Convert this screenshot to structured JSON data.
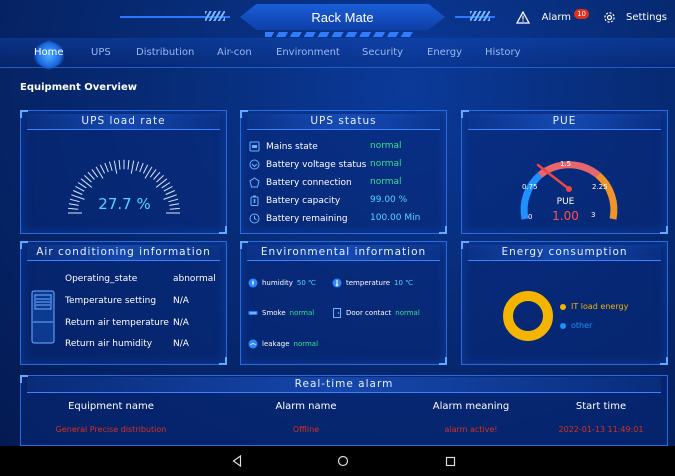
{
  "header": {
    "title": "Rack Mate",
    "alarm_label": "Alarm",
    "alarm_count": "10",
    "settings_label": "Settings"
  },
  "nav": {
    "items": [
      {
        "label": "Home"
      },
      {
        "label": "UPS"
      },
      {
        "label": "Distribution"
      },
      {
        "label": "Air-con"
      },
      {
        "label": "Environment"
      },
      {
        "label": "Security"
      },
      {
        "label": "Energy"
      },
      {
        "label": "History"
      }
    ]
  },
  "overview_title": "Equipment Overview",
  "ups_load": {
    "title": "UPS load rate",
    "value_text": "27.7 %",
    "value": 27.7
  },
  "ups_status": {
    "title": "UPS status",
    "rows": [
      {
        "label": "Mains state",
        "value": "normal",
        "icon": "plug-icon"
      },
      {
        "label": "Battery voltage status",
        "value": "normal",
        "icon": "voltage-icon"
      },
      {
        "label": "Battery connection",
        "value": "normal",
        "icon": "link-icon"
      },
      {
        "label": "Battery capacity",
        "value": "99.00 %",
        "icon": "battery-icon"
      },
      {
        "label": "Battery remaining",
        "value": "100.00 Min",
        "icon": "clock-icon"
      }
    ]
  },
  "pue": {
    "title": "PUE",
    "label": "PUE",
    "value": "1.00",
    "ticks": [
      "0",
      "0.75",
      "1.5",
      "2.25",
      "3"
    ]
  },
  "aircon": {
    "title": "Air conditioning information",
    "rows": [
      {
        "label": "Operating_state",
        "value": "abnormal"
      },
      {
        "label": "Temperature setting",
        "value": "N/A"
      },
      {
        "label": "Return air temperature",
        "value": "N/A"
      },
      {
        "label": "Return air humidity",
        "value": "N/A"
      }
    ]
  },
  "environment": {
    "title": "Environmental information",
    "humidity_label": "humidity",
    "humidity_value": "50 ℃",
    "temperature_label": "temperature",
    "temperature_value": "10 ℃",
    "smoke_label": "Smoke",
    "smoke_value": "normal",
    "door_label": "Door contact",
    "door_value": "normal",
    "leakage_label": "leakage",
    "leakage_value": "normal"
  },
  "energy": {
    "title": "Energy consumption",
    "legend": [
      {
        "label": "IT load energy",
        "color": "#f4b400"
      },
      {
        "label": "other",
        "color": "#1e90ff"
      }
    ]
  },
  "alarm_table": {
    "title": "Real-time alarm",
    "headers": [
      "Equipment name",
      "Alarm name",
      "Alarm meaning",
      "Start time"
    ],
    "rows": [
      [
        "General Precise distribution",
        "Offline",
        "alarm active!",
        "2022-01-13 11:49:01"
      ]
    ]
  },
  "colors": {
    "normal": "#35e08a",
    "abnormal": "#ff6a3a",
    "na": "#4fa3ff",
    "alarm_red": "#d8301e"
  }
}
